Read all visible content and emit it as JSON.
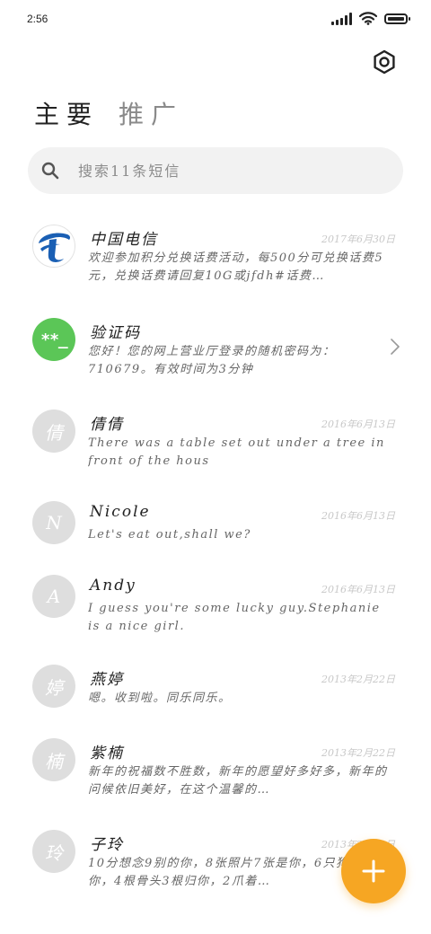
{
  "status_bar": {
    "time": "2:56"
  },
  "tabs": [
    {
      "label": "主要",
      "active": true
    },
    {
      "label": "推广",
      "active": false
    }
  ],
  "search": {
    "placeholder": "搜索11条短信"
  },
  "conversations": [
    {
      "name": "中国电信",
      "time": "2017年6月30日",
      "preview": "欢迎参加积分兑换话费活动，每500分可兑换话费5元，兑换话费请回复10G或jfdh#话费…",
      "avatar": "telecom-logo"
    },
    {
      "name": "验证码",
      "time": "",
      "preview": "您好！您的网上营业厅登录的随机密码为：710679。有效时间为3分钟",
      "avatar_text": "**_"
    },
    {
      "name": "倩倩",
      "time": "2016年6月13日",
      "preview": "There was a table set out under a tree in front of the hous",
      "avatar_text": "倩"
    },
    {
      "name": "Nicole",
      "time": "2016年6月13日",
      "preview": "Let's eat out,shall we?",
      "avatar_text": "N"
    },
    {
      "name": "Andy",
      "time": "2016年6月13日",
      "preview": "I guess you're some lucky guy.Stephanie is a nice girl.",
      "avatar_text": "A"
    },
    {
      "name": "燕婷",
      "time": "2013年2月22日",
      "preview": "嗯。收到啦。同乐同乐。",
      "avatar_text": "婷"
    },
    {
      "name": "紫楠",
      "time": "2013年2月22日",
      "preview": "新年的祝福数不胜数，新年的愿望好多好多，新年的问候依旧美好，在这个温馨的…",
      "avatar_text": "楠"
    },
    {
      "name": "子玲",
      "time": "2013年2月22日",
      "preview": "10分想念9别的你，8张照片7张是你，6只狗5只像你，4根骨头3根归你，2爪着…",
      "avatar_text": "玲"
    }
  ],
  "colors": {
    "accent": "#f6a623",
    "green_avatar": "#5bc657",
    "telecom_blue": "#1a5fb4"
  },
  "icons": {
    "settings": "gear-icon",
    "search": "search-icon",
    "chevron": "chevron-right-icon",
    "fab": "plus-icon"
  }
}
